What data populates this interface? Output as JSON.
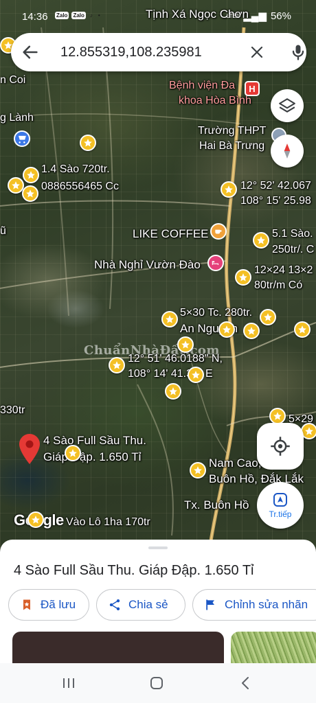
{
  "status_bar": {
    "time": "14:36",
    "app_icons": [
      "Zalo",
      "Zalo"
    ],
    "battery": "56%",
    "network": "LTE1"
  },
  "search": {
    "query": "12.855319,108.235981"
  },
  "map": {
    "labels": {
      "tinh_xa": "Tịnh Xá Ngọc Chơn",
      "benh_vien_1": "Bệnh viện Đa",
      "benh_vien_2": "khoa Hòa Bình",
      "truong_1": "Trường THPT",
      "truong_2": "Hai Bà Trưng",
      "n_coi": "n Coi",
      "g_lanh": "g Lành",
      "sao14": "1.4 Sào 720tr.",
      "phone": "0886556465 Cc",
      "coord1_a": "12° 52' 42.067",
      "coord1_b": "108° 15' 25.98",
      "like_coffee": "LIKE COFFEE",
      "sao51_a": "5.1 Sào.",
      "sao51_b": "250tr/. C",
      "nha_nghi": "Nhà Nghỉ Vườn Đào",
      "size12_a": "12×24 13×2",
      "size12_b": "80tr/m Có",
      "plot530": "5×30 Tc. 280tr.",
      "an_nguyen": "An Nguyên",
      "coord2_a": "12° 51' 46.0188\" N,",
      "coord2_b": "108° 14' 41.34\" E",
      "p330": "330tr",
      "sau_thu_1": "4 Sào Full Sầu Thu.",
      "sau_thu_2": "Giáp Đập. 1.650 Tỉ",
      "size529": "5×29",
      "nam_cao_1": "Nam Cao, T",
      "nam_cao_2": "Buôn Hồ, Đắk Lắk",
      "tx_buon_ho": "Tx. Buôn Hồ",
      "vao_lo": "Vào Lô 1ha 170tr",
      "google": "Google",
      "watermark": "ChuẩnNhàĐất.com",
      "fragment_u": "ũ"
    },
    "controls": {
      "navigate_label": "Tr.tiếp"
    }
  },
  "sheet": {
    "title": "4 Sào Full Sầu Thu. Giáp Đập. 1.650 Tỉ",
    "chips": {
      "saved": "Đã lưu",
      "share": "Chia sẻ",
      "edit": "Chỉnh sửa nhãn"
    }
  },
  "colors": {
    "accent": "#1a56c5",
    "star": "#f4c025",
    "pin": "#e53935",
    "hospital": "#e53935",
    "coffee": "#f0a13a"
  }
}
